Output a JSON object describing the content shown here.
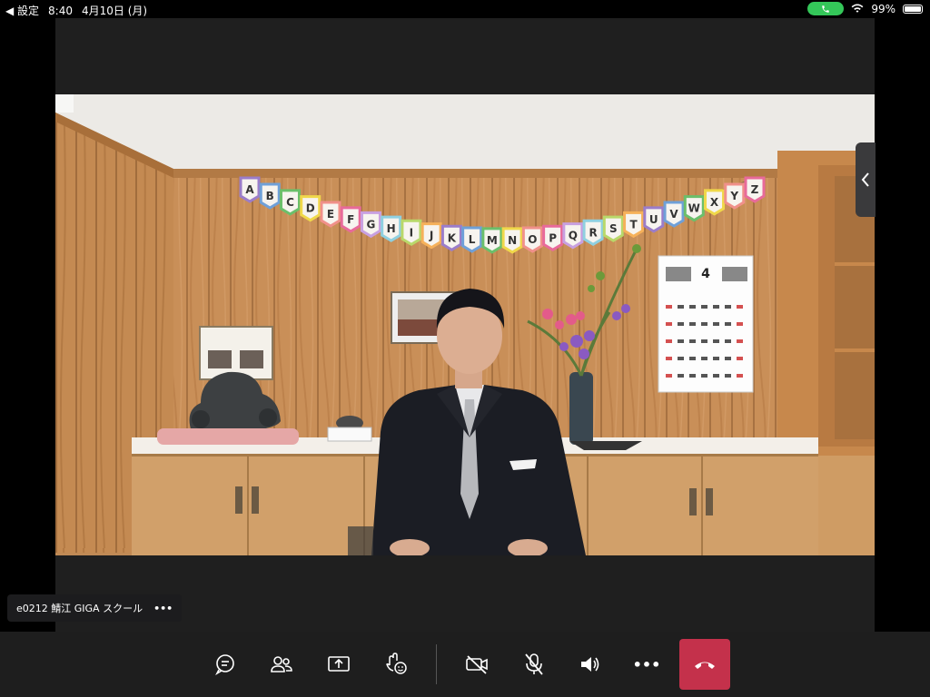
{
  "status_bar": {
    "back_label": "◀ 設定",
    "time": "8:40",
    "date": "4月10日 (月)",
    "battery": "99%",
    "battery_level": 0.99
  },
  "video_scene": {
    "alphabet_banner": [
      "A",
      "B",
      "C",
      "D",
      "E",
      "F",
      "G",
      "H",
      "I",
      "J",
      "K",
      "L",
      "M",
      "N",
      "O",
      "P",
      "Q",
      "R",
      "S",
      "T",
      "U",
      "V",
      "W",
      "X",
      "Y",
      "Z"
    ],
    "calendar_month": "4"
  },
  "participant": {
    "name": "e0212 鯖江 GIGA スクール",
    "more_label": "•••"
  },
  "controls": {
    "chat_icon": "chat-icon",
    "people_icon": "people-icon",
    "share_icon": "share-screen-icon",
    "reactions_icon": "reactions-icon",
    "camera_icon": "camera-off-icon",
    "mic_icon": "mic-off-icon",
    "speaker_icon": "speaker-icon",
    "more_icon": "more-icon",
    "more_label": "•••",
    "hangup_icon": "hang-up-icon"
  },
  "colors": {
    "hangup": "#c4314b",
    "call_pill": "#34c759",
    "control_bar": "#1e1e1e"
  }
}
